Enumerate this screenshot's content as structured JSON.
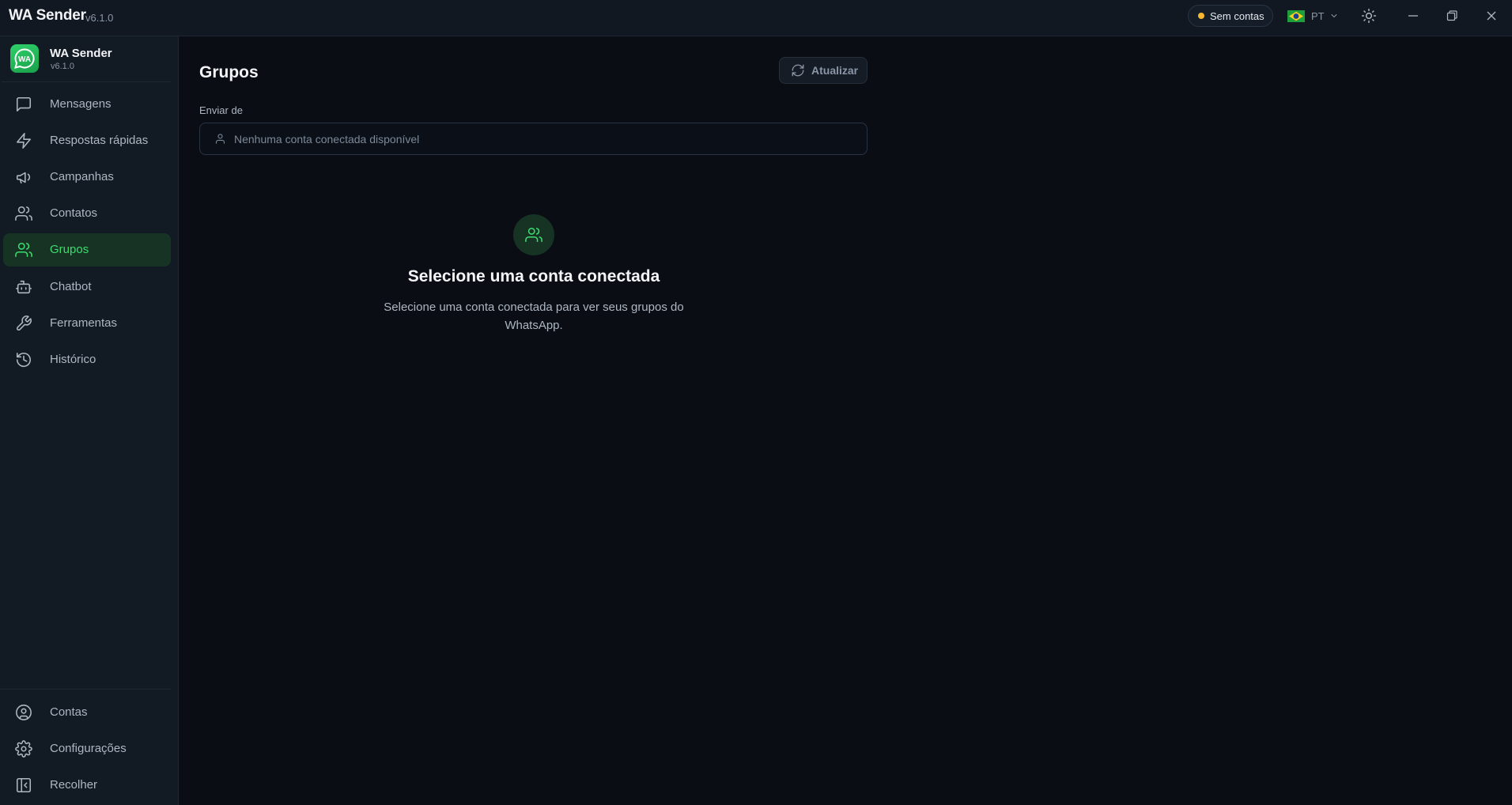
{
  "titlebar": {
    "app_title": "WA Sender",
    "app_version": "v6.1.0",
    "status": "Sem contas",
    "status_color": "#f5b82e",
    "language": "PT",
    "icons": [
      "sun-icon",
      "minimize-icon",
      "restore-icon",
      "close-icon"
    ]
  },
  "sidebar": {
    "brand_name": "WA Sender",
    "brand_version": "v6.1.0",
    "brand_logo_text": "WA",
    "items": [
      {
        "label": "Mensagens",
        "icon": "message-square-icon"
      },
      {
        "label": "Respostas rápidas",
        "icon": "lightning-icon"
      },
      {
        "label": "Campanhas",
        "icon": "megaphone-icon"
      },
      {
        "label": "Contatos",
        "icon": "users-icon"
      },
      {
        "label": "Grupos",
        "icon": "users-icon",
        "active": true
      },
      {
        "label": "Chatbot",
        "icon": "bot-icon"
      },
      {
        "label": "Ferramentas",
        "icon": "wrench-icon"
      },
      {
        "label": "Histórico",
        "icon": "history-icon"
      }
    ],
    "bottom_items": [
      {
        "label": "Contas",
        "icon": "user-circle-icon"
      },
      {
        "label": "Configurações",
        "icon": "gear-icon"
      },
      {
        "label": "Recolher",
        "icon": "collapse-sidebar-icon"
      }
    ]
  },
  "main": {
    "title": "Grupos",
    "refresh_label": "Atualizar",
    "send_from_label": "Enviar de",
    "account_placeholder": "Nenhuma conta conectada disponível",
    "empty_title": "Selecione uma conta conectada",
    "empty_description": "Selecione uma conta conectada para ver seus grupos do WhatsApp."
  },
  "colors": {
    "accent": "#3ddc6f",
    "active_bg": "#163324",
    "background": "#0a0e14",
    "sidebar_bg": "#121a24"
  }
}
